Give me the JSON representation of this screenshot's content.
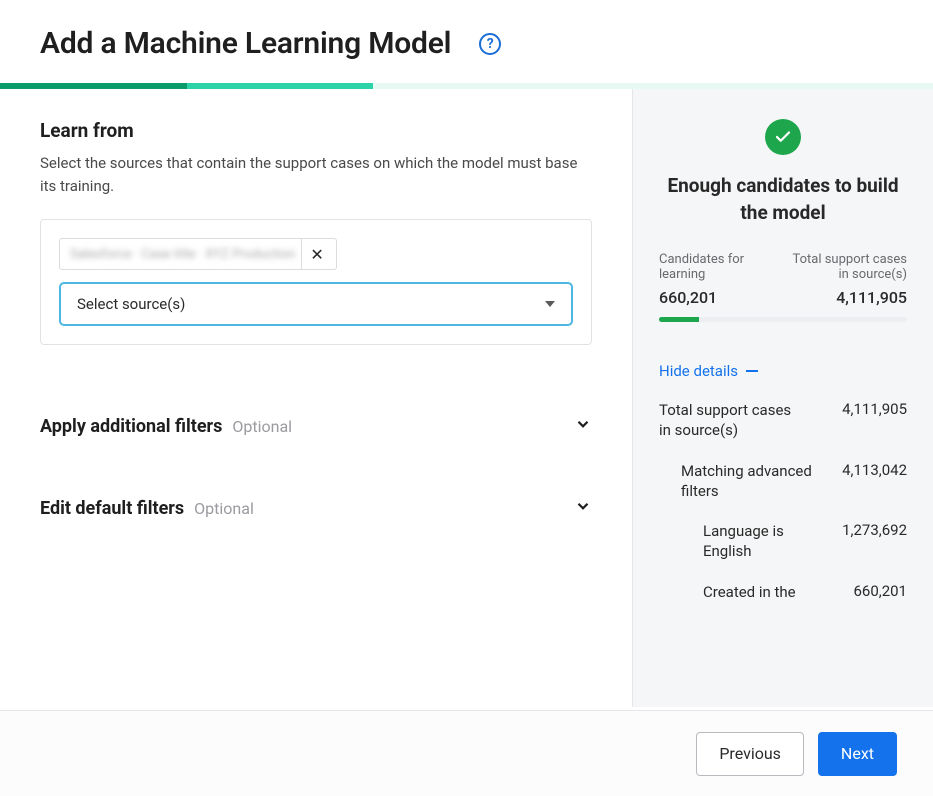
{
  "header": {
    "title": "Add a Machine Learning Model"
  },
  "learn_from": {
    "title": "Learn from",
    "description": "Select the sources that contain the support cases on which the model must base its training.",
    "chip_label": "Salesforce · Case title · XYZ Production",
    "select_placeholder": "Select source(s)"
  },
  "filters": {
    "additional_label": "Apply additional filters",
    "additional_optional": "Optional",
    "default_label": "Edit default filters",
    "default_optional": "Optional"
  },
  "status": {
    "title": "Enough candidates to build the model",
    "candidates_label": "Candidates for learning",
    "total_label": "Total support cases in source(s)",
    "candidates_value": "660,201",
    "total_value": "4,111,905",
    "hide_details": "Hide details"
  },
  "details": {
    "row1_label": "Total support cases in source(s)",
    "row1_value": "4,111,905",
    "row2_label": "Matching advanced filters",
    "row2_value": "4,113,042",
    "row3_label": "Language is English",
    "row3_value": "1,273,692",
    "row4_label": "Created in the",
    "row4_value": "660,201"
  },
  "footer": {
    "previous": "Previous",
    "next": "Next"
  }
}
